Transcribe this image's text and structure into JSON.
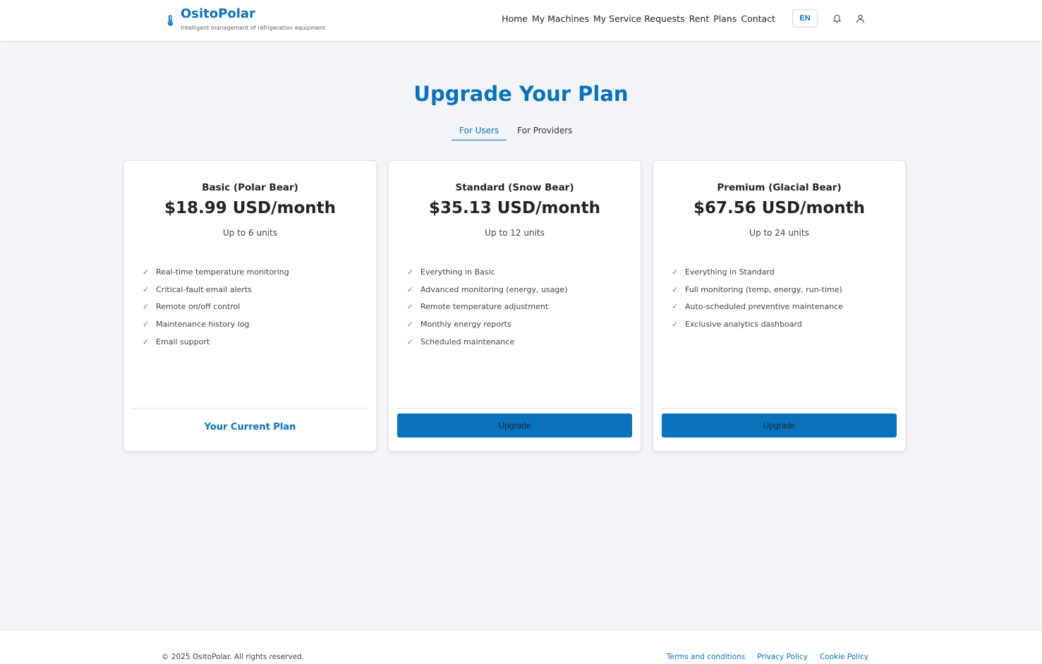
{
  "header": {
    "brand_name": "OsitoPolar",
    "tagline": "Intelligent management of refrigeration equipment",
    "brand_icon": "thermometer-icon",
    "nav": [
      {
        "label": "Home"
      },
      {
        "label": "My Machines"
      },
      {
        "label": "My Service Requests"
      },
      {
        "label": "Rent"
      },
      {
        "label": "Plans"
      },
      {
        "label": "Contact"
      }
    ],
    "language": "EN",
    "icons": [
      "bell-icon",
      "user-icon"
    ]
  },
  "page": {
    "title": "Upgrade Your Plan",
    "tabs": [
      {
        "label": "For Users",
        "active": true
      },
      {
        "label": "For Providers",
        "active": false
      }
    ]
  },
  "plans": [
    {
      "name": "Basic (Polar Bear)",
      "price": "$18.99 USD/month",
      "units": "Up to 6 units",
      "features": [
        "Real-time temperature monitoring",
        "Critical-fault email alerts",
        "Remote on/off control",
        "Maintenance history log",
        "Email support"
      ],
      "action": "Your Current Plan",
      "is_current": true
    },
    {
      "name": "Standard (Snow Bear)",
      "price": "$35.13 USD/month",
      "units": "Up to 12 units",
      "features": [
        "Everything in Basic",
        "Advanced monitoring (energy, usage)",
        "Remote temperature adjustment",
        "Monthly energy reports",
        "Scheduled maintenance"
      ],
      "action": "Upgrade",
      "is_current": false
    },
    {
      "name": "Premium (Glacial Bear)",
      "price": "$67.56 USD/month",
      "units": "Up to 24 units",
      "features": [
        "Everything in Standard",
        "Full monitoring (temp, energy, run-time)",
        "Auto-scheduled preventive maintenance",
        "Exclusive analytics dashboard"
      ],
      "action": "Upgrade",
      "is_current": false
    }
  ],
  "footer": {
    "copyright": "© 2025 OsitoPolar. All rights reserved.",
    "links": [
      {
        "label": "Terms and conditions"
      },
      {
        "label": "Privacy Policy"
      },
      {
        "label": "Cookie Policy"
      }
    ]
  },
  "colors": {
    "accent": "#0a72bd",
    "background": "#f4f5f9",
    "check": "#3a9b4a"
  }
}
